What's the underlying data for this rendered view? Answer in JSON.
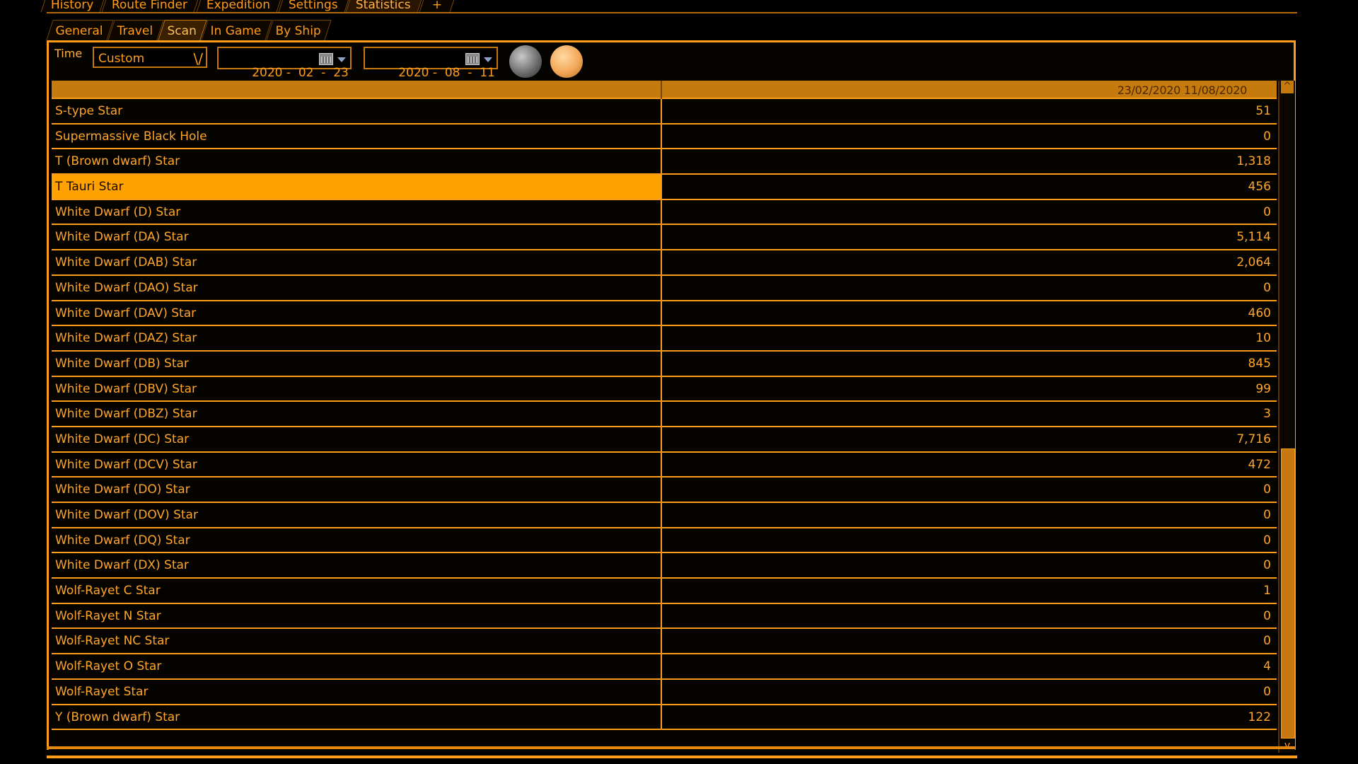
{
  "main_tabs": [
    "History",
    "Route Finder",
    "Expedition",
    "Settings",
    "Statistics",
    "+"
  ],
  "sub_tabs": [
    "General",
    "Travel",
    "Scan",
    "In Game",
    "By Ship"
  ],
  "toolbar": {
    "time_label": "Time",
    "time_select_value": "Custom",
    "date_from": "2020 -  02  -  23",
    "date_to": "2020 -  08  -  11"
  },
  "table": {
    "header_dates": "23/02/2020  11/08/2020",
    "rows": [
      {
        "name": "S-type Star",
        "value": "51"
      },
      {
        "name": "Supermassive Black Hole",
        "value": "0"
      },
      {
        "name": "T (Brown dwarf) Star",
        "value": "1,318"
      },
      {
        "name": "T Tauri Star",
        "value": "456"
      },
      {
        "name": "White Dwarf (D) Star",
        "value": "0"
      },
      {
        "name": "White Dwarf (DA) Star",
        "value": "5,114"
      },
      {
        "name": "White Dwarf (DAB) Star",
        "value": "2,064"
      },
      {
        "name": "White Dwarf (DAO) Star",
        "value": "0"
      },
      {
        "name": "White Dwarf (DAV) Star",
        "value": "460"
      },
      {
        "name": "White Dwarf (DAZ) Star",
        "value": "10"
      },
      {
        "name": "White Dwarf (DB) Star",
        "value": "845"
      },
      {
        "name": "White Dwarf (DBV) Star",
        "value": "99"
      },
      {
        "name": "White Dwarf (DBZ) Star",
        "value": "3"
      },
      {
        "name": "White Dwarf (DC) Star",
        "value": "7,716"
      },
      {
        "name": "White Dwarf (DCV) Star",
        "value": "472"
      },
      {
        "name": "White Dwarf (DO) Star",
        "value": "0"
      },
      {
        "name": "White Dwarf (DOV) Star",
        "value": "0"
      },
      {
        "name": "White Dwarf (DQ) Star",
        "value": "0"
      },
      {
        "name": "White Dwarf (DX) Star",
        "value": "0"
      },
      {
        "name": "Wolf-Rayet C Star",
        "value": "1"
      },
      {
        "name": "Wolf-Rayet N Star",
        "value": "0"
      },
      {
        "name": "Wolf-Rayet NC Star",
        "value": "0"
      },
      {
        "name": "Wolf-Rayet O Star",
        "value": "4"
      },
      {
        "name": "Wolf-Rayet Star",
        "value": "0"
      },
      {
        "name": "Y (Brown dwarf) Star",
        "value": "122"
      }
    ]
  },
  "colors": {
    "accent": "#ff9c1a",
    "selected_row": "#ffa200",
    "header": "#c47a0c"
  },
  "icons": {
    "scroll_up": "^",
    "scroll_down": "v",
    "select_chevron": "\\/"
  }
}
